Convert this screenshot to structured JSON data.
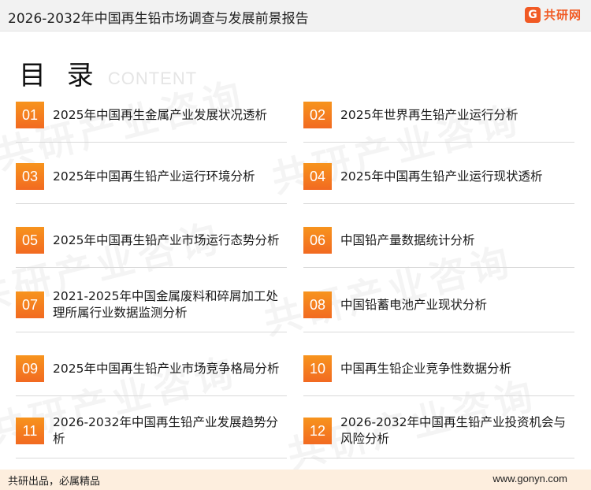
{
  "header": {
    "title": "2026-2032年中国再生铅市场调查与发展前景报告",
    "logo_mark": "G",
    "logo_text": "共研网"
  },
  "watermark": "共研产业咨询",
  "toc": {
    "heading_cn": "目 录",
    "heading_en": "CONTENT",
    "items": [
      {
        "num": "01",
        "label": "2025年中国再生金属产业发展状况透析"
      },
      {
        "num": "02",
        "label": "2025年世界再生铅产业运行分析"
      },
      {
        "num": "03",
        "label": "2025年中国再生铅产业运行环境分析"
      },
      {
        "num": "04",
        "label": "2025年中国再生铅产业运行现状透析"
      },
      {
        "num": "05",
        "label": "2025年中国再生铅产业市场运行态势分析"
      },
      {
        "num": "06",
        "label": "中国铅产量数据统计分析"
      },
      {
        "num": "07",
        "label": "2021-2025年中国金属废料和碎屑加工处理所属行业数据监测分析"
      },
      {
        "num": "08",
        "label": "中国铅蓄电池产业现状分析"
      },
      {
        "num": "09",
        "label": "2025年中国再生铅产业市场竞争格局分析"
      },
      {
        "num": "10",
        "label": "中国再生铅企业竞争性数据分析"
      },
      {
        "num": "11",
        "label": "2026-2032年中国再生铅产业发展趋势分析"
      },
      {
        "num": "12",
        "label": "2026-2032年中国再生铅产业投资机会与风险分析"
      }
    ]
  },
  "footer": {
    "slogan": "共研出品，必属精品",
    "site": "www.gonyn.com"
  },
  "colors": {
    "accent_orange": "#f26a21",
    "footer_bg": "#fdeede"
  }
}
